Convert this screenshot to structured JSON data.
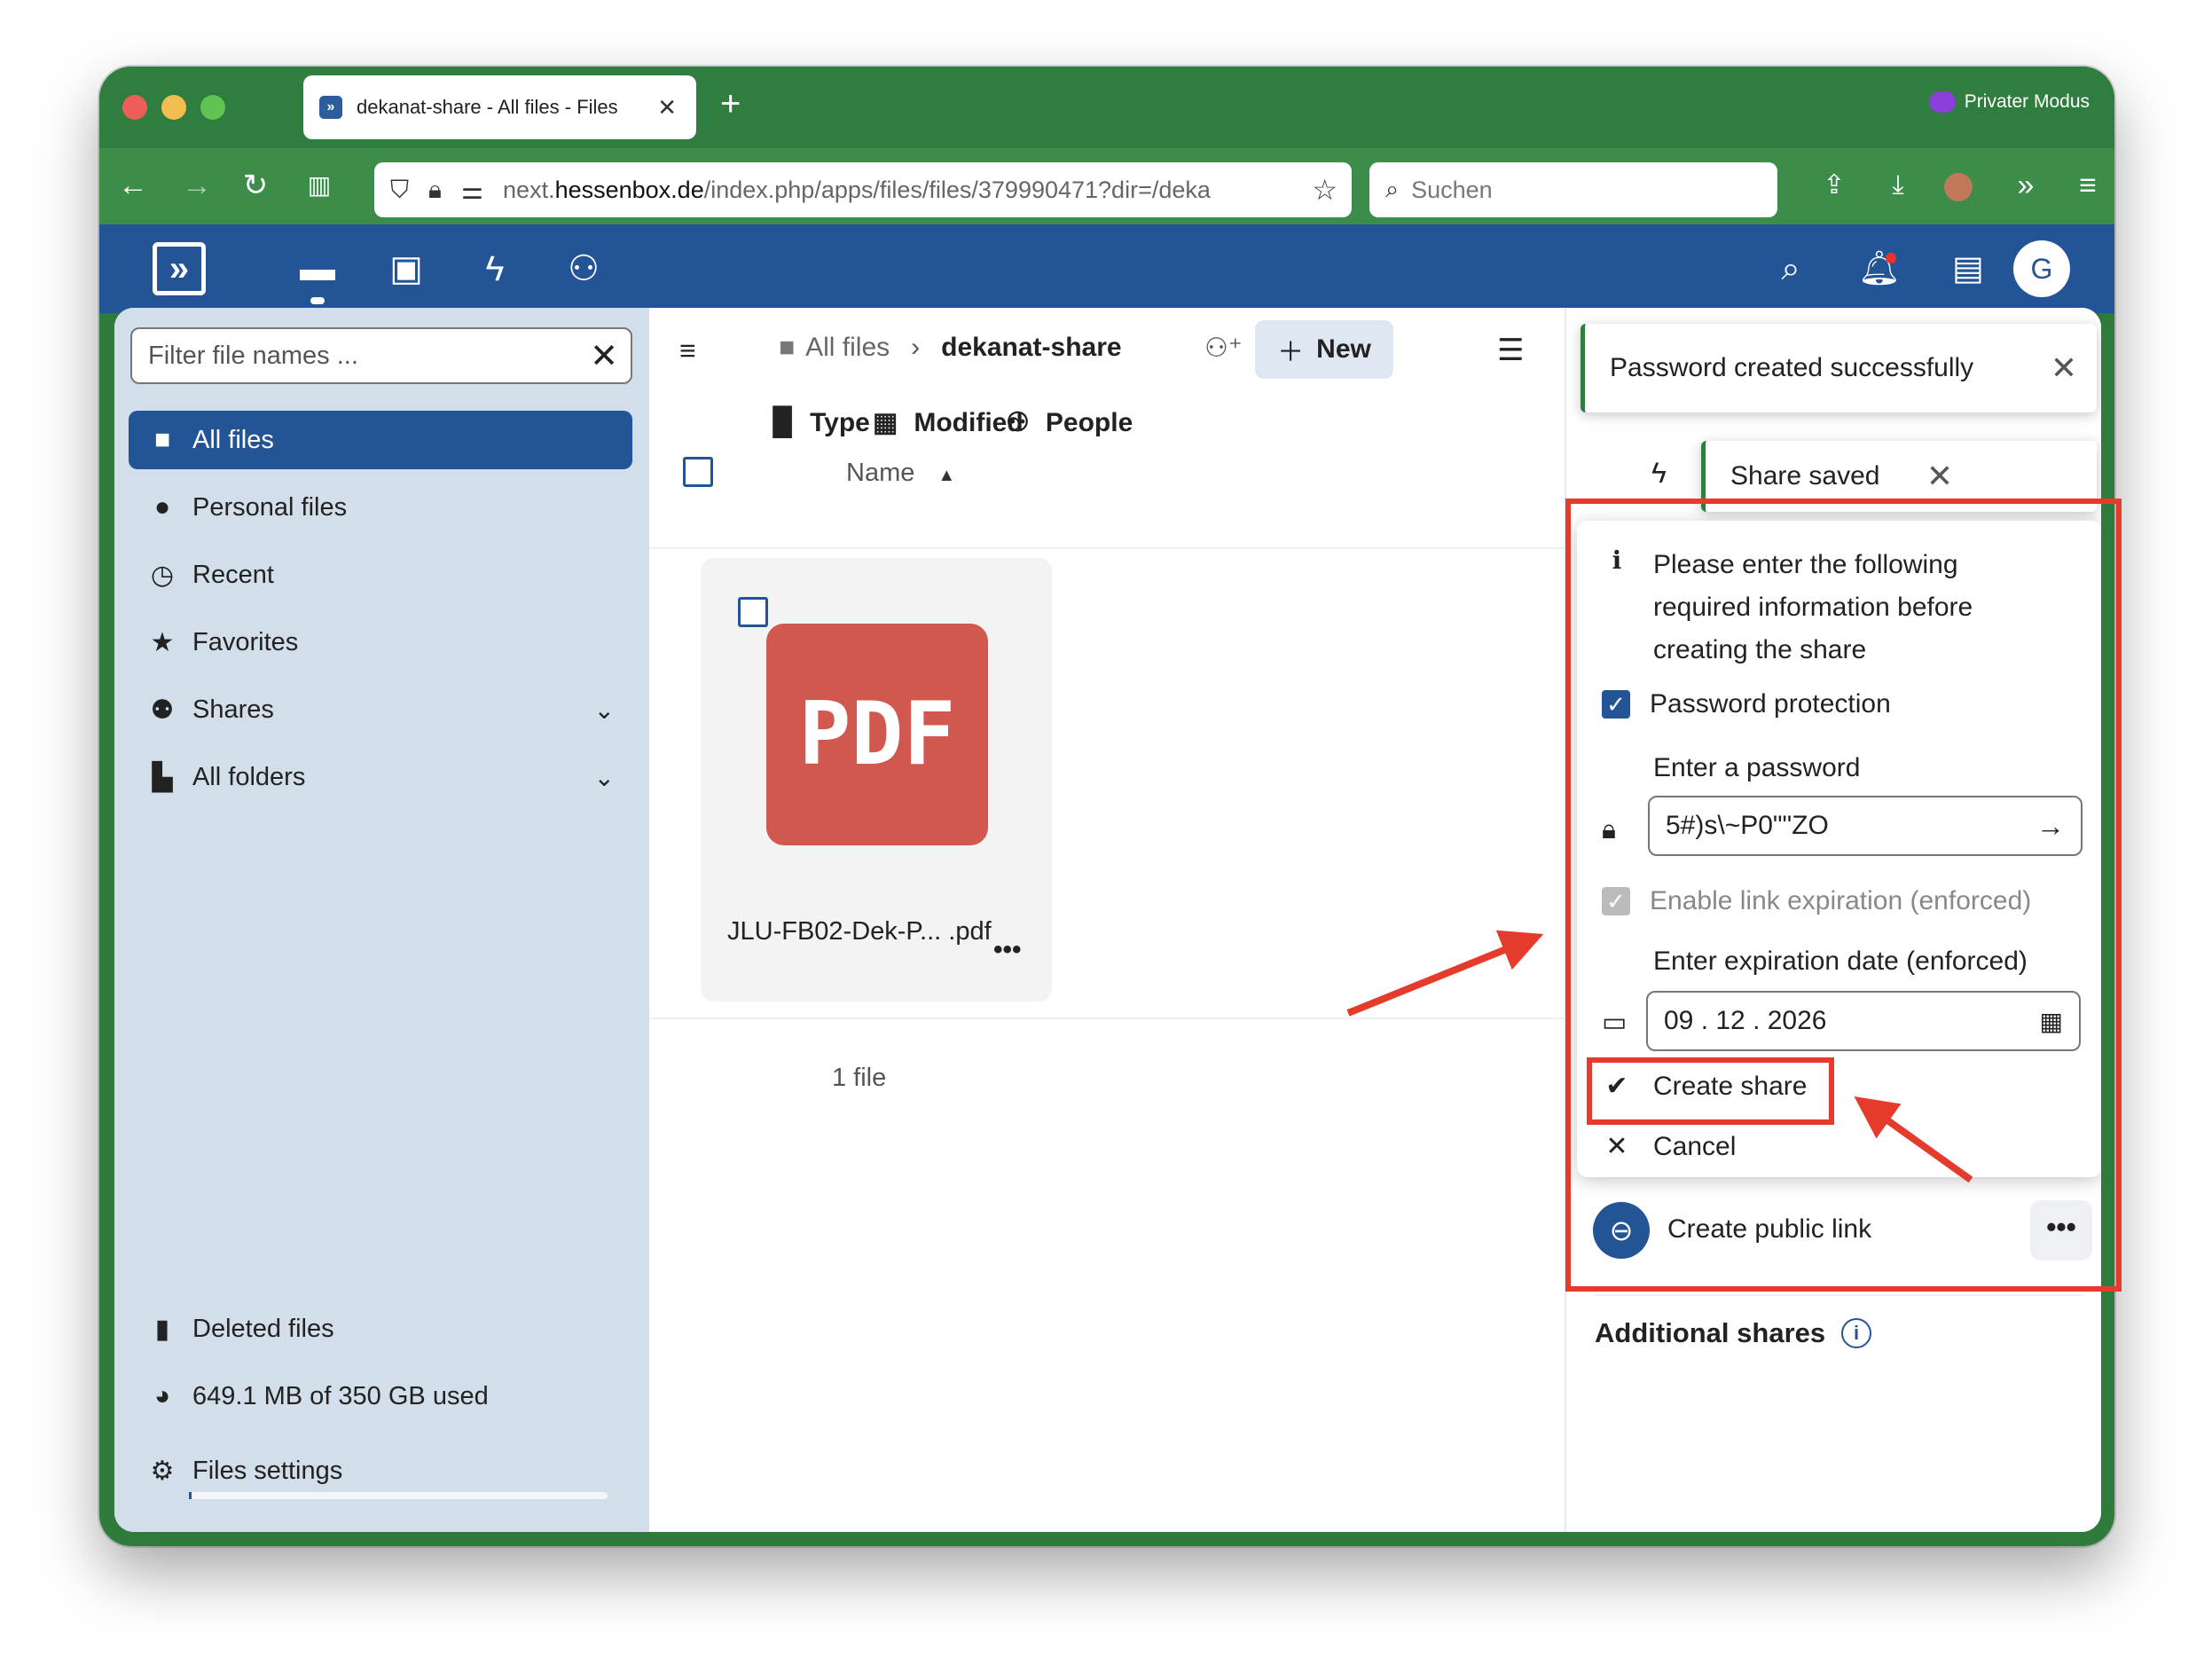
{
  "browser": {
    "tab_title": "dekanat-share - All files - Files",
    "private_mode": "Privater Modus",
    "url_prefix": "next.",
    "url_host": "hessenbox.de",
    "url_path": "/index.php/apps/files/files/379990471?dir=/deka",
    "search_placeholder": "Suchen"
  },
  "app_header": {
    "avatar_letter": "G"
  },
  "sidebar": {
    "filter_placeholder": "Filter file names ...",
    "items": [
      {
        "label": "All files",
        "icon": "folder-icon"
      },
      {
        "label": "Personal files",
        "icon": "person-icon"
      },
      {
        "label": "Recent",
        "icon": "history-icon"
      },
      {
        "label": "Favorites",
        "icon": "star-icon"
      },
      {
        "label": "Shares",
        "icon": "share-icon"
      },
      {
        "label": "All folders",
        "icon": "folders-icon"
      }
    ],
    "deleted": "Deleted files",
    "storage": "649.1 MB of 350 GB used",
    "storage_fraction": 0.0018,
    "settings": "Files settings"
  },
  "main": {
    "breadcrumb_root": "All files",
    "breadcrumb_current": "dekanat-share",
    "new_button": "New",
    "filters": [
      "Type",
      "Modified",
      "People"
    ],
    "column_name": "Name",
    "file_name": "JLU-FB02-Dek-P... .pdf",
    "file_type_label": "PDF",
    "file_count": "1 file"
  },
  "share_panel": {
    "toast_password": "Password created successfully",
    "toast_share": "Share saved",
    "info_text_lines": [
      "Please enter the following",
      "required information before",
      "creating the share"
    ],
    "password_protection": "Password protection",
    "password_label": "Enter a password",
    "password_value": "5#)s\\~P0\"\"ZO",
    "expiration_checkbox": "Enable link expiration (enforced)",
    "expiration_label": "Enter expiration date (enforced)",
    "expiration_value": "09 . 12 . 2026",
    "create_share": "Create share",
    "cancel": "Cancel",
    "public_link": "Create public link",
    "additional_shares": "Additional shares"
  },
  "colors": {
    "brand": "#235596",
    "browser_green": "#2f7d3f",
    "annotation_red": "#e53b2c",
    "pdf_red": "#d1584e"
  }
}
